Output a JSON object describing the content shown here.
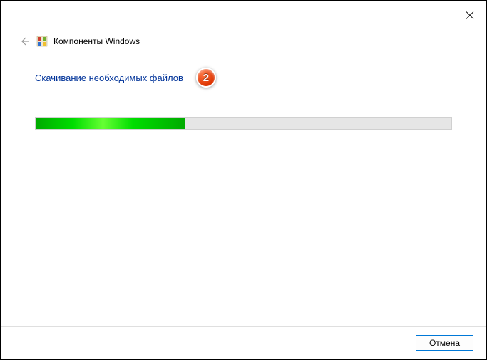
{
  "window": {
    "title": "Компоненты Windows"
  },
  "content": {
    "status": "Скачивание необходимых файлов",
    "badge_number": "2",
    "progress_percent": 36
  },
  "footer": {
    "cancel_label": "Отмена"
  }
}
